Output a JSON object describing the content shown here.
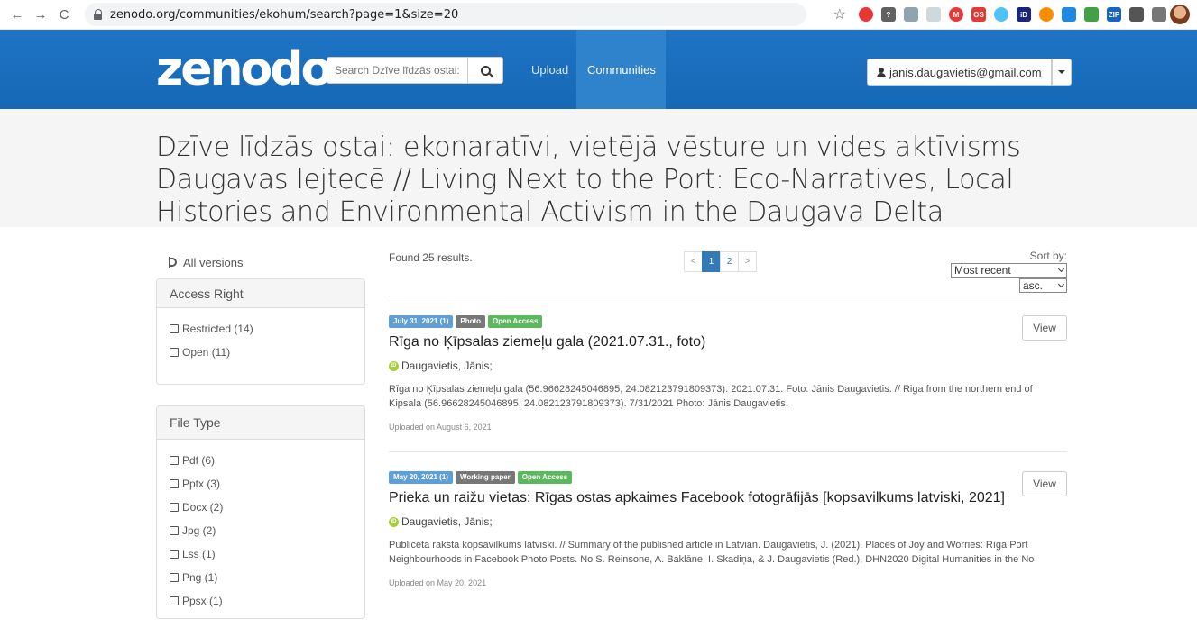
{
  "browser": {
    "url": "zenodo.org/communities/ekohum/search?page=1&size=20",
    "extensions": [
      {
        "name": "opera-icon",
        "color": "#e53935",
        "shape": "circle",
        "text": ""
      },
      {
        "name": "ext-question-icon",
        "color": "#616161",
        "shape": "square",
        "text": "?"
      },
      {
        "name": "ext-edit-icon",
        "color": "#90a4ae",
        "shape": "square",
        "text": ""
      },
      {
        "name": "ext-doc-icon",
        "color": "#cfd8dc",
        "shape": "square",
        "text": ""
      },
      {
        "name": "ext-m-icon",
        "color": "#e53935",
        "shape": "circle",
        "text": "M"
      },
      {
        "name": "ext-os-icon",
        "color": "#e53935",
        "shape": "square",
        "text": "OS"
      },
      {
        "name": "ext-react-icon",
        "color": "#4fc3f7",
        "shape": "circle",
        "text": ""
      },
      {
        "name": "ext-id-icon",
        "color": "#1a237e",
        "shape": "square",
        "text": "iD"
      },
      {
        "name": "ext-circle-icon",
        "color": "#fb8c00",
        "shape": "circle",
        "text": ""
      },
      {
        "name": "ext-diamond-icon",
        "color": "#1e88e5",
        "shape": "square",
        "text": ""
      },
      {
        "name": "ext-book-icon",
        "color": "#43a047",
        "shape": "square",
        "text": ""
      },
      {
        "name": "ext-zip-icon",
        "color": "#1565c0",
        "shape": "square",
        "text": "ZIP"
      },
      {
        "name": "puzzle-icon",
        "color": "#555555",
        "shape": "square",
        "text": ""
      },
      {
        "name": "reading-list-icon",
        "color": "#777777",
        "shape": "square",
        "text": ""
      }
    ]
  },
  "navbar": {
    "logo": "zenodo",
    "search_placeholder": "Search Dzīve līdzās ostai: e",
    "upload": "Upload",
    "communities": "Communities",
    "user": "janis.daugavietis@gmail.com",
    "brand_color": "#1f74c4"
  },
  "header": {
    "title": "Dzīve līdzās ostai: ekonaratīvi, vietējā vēsture un vides aktīvisms Daugavas lejtecē // Living Next to the Port: Eco-Narratives, Local Histories and Environmental Activism in the Daugava Delta"
  },
  "sidebar": {
    "all_versions": "All versions",
    "access_right": {
      "title": "Access Right",
      "items": [
        "Restricted (14)",
        "Open (11)"
      ]
    },
    "file_type": {
      "title": "File Type",
      "items": [
        "Pdf (6)",
        "Pptx (3)",
        "Docx (2)",
        "Jpg (2)",
        "Lss (1)",
        "Png (1)",
        "Ppsx (1)"
      ]
    }
  },
  "results": {
    "found": "Found 25 results.",
    "pager": [
      "<",
      "1",
      "2",
      ">"
    ],
    "sort_by_label": "Sort by:",
    "sort_value": "Most recent",
    "order_value": "asc.",
    "view_label": "View",
    "records": [
      {
        "date_badge": "July 31, 2021 (1)",
        "type_badge": "Photo",
        "access_badge": "Open Access",
        "title": "Rīga no Ķīpsalas ziemeļu gala (2021.07.31., foto)",
        "creators": "Daugavietis, Jānis;",
        "description": "Rīga no Ķīpsalas ziemeļu gala (56.96628245046895, 24.082123791809373). 2021.07.31. Foto: Jānis Daugavietis. // Riga from the northern end of Kipsala (56.96628245046895, 24.082123791809373). 7/31/2021 Photo: Jānis Daugavietis.",
        "uploaded": "Uploaded on August 6, 2021"
      },
      {
        "date_badge": "May 20, 2021 (1)",
        "type_badge": "Working paper",
        "access_badge": "Open Access",
        "title": "Prieka un raižu vietas: Rīgas ostas apkaimes Facebook fotogrāfijās [kopsavilkums latviski, 2021]",
        "creators": "Daugavietis, Jānis;",
        "description": "Publicēta raksta kopsavilkums latviski. // Summary of the published article in Latvian. Daugavietis, J. (2021). Places of Joy and Worries: Rīga Port Neighbourhoods in Facebook Photo Posts. No S. Reinsone, A. Baklāne, I. Skadiņa, & J. Daugavietis (Red.), DHN2020 Digital Humanities in the No",
        "uploaded": "Uploaded on May 20, 2021"
      }
    ]
  }
}
